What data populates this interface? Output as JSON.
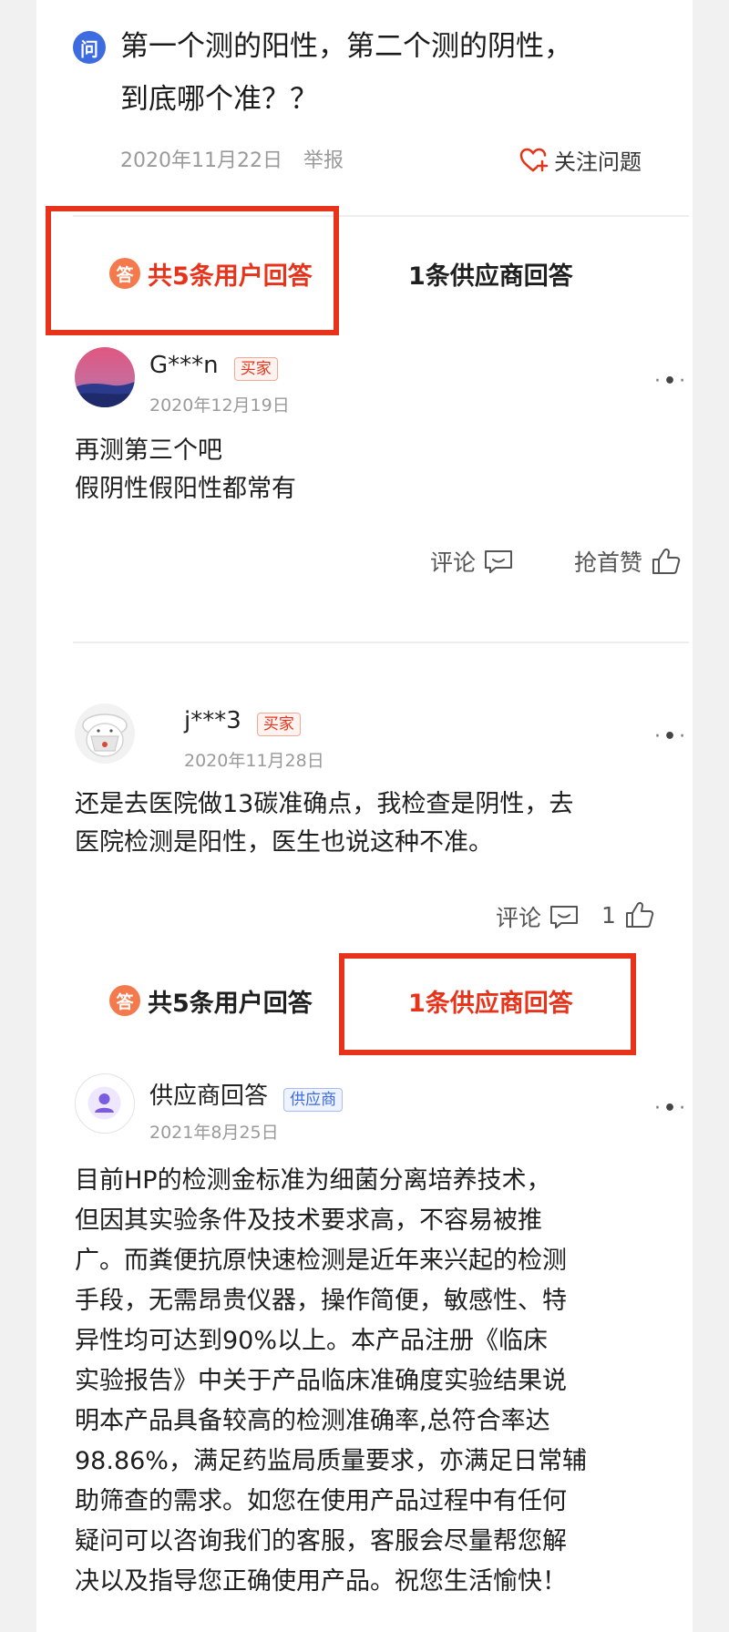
{
  "question": {
    "icon_label": "问",
    "title_line1": "第一个测的阳性，第二个测的阴性，",
    "title_line2": "到底哪个准？？",
    "date": "2020年11月22日",
    "report": "举报",
    "follow": "关注问题"
  },
  "tabs": {
    "badge": "答",
    "user_answers": "共5条用户回答",
    "supplier_answers": "1条供应商回答"
  },
  "answers": [
    {
      "user": "G***n",
      "tag": "买家",
      "date": "2020年12月19日",
      "line1": "再测第三个吧",
      "line2": "假阴性假阳性都常有",
      "comment": "评论",
      "like": "抢首赞"
    },
    {
      "user": "j***3",
      "tag": "买家",
      "date": "2020年11月28日",
      "line1": "还是去医院做13碳准确点，我检查是阴性，去",
      "line2": "医院检测是阳性，医生也说这种不准。",
      "comment": "评论",
      "like": "1"
    }
  ],
  "supplier": {
    "name": "供应商回答",
    "tag": "供应商",
    "date": "2021年8月25日",
    "lines": [
      "目前HP的检测金标准为细菌分离培养技术，",
      "但因其实验条件及技术要求高，不容易被推",
      "广。而粪便抗原快速检测是近年来兴起的检测",
      "手段，无需昂贵仪器，操作简便，敏感性、特",
      "异性均可达到90%以上。本产品注册《临床",
      "实验报告》中关于产品临床准确度实验结果说",
      "明本产品具备较高的检测准确率,总符合率达",
      "98.86%，满足药监局质量要求，亦满足日常辅",
      "助筛查的需求。如您在使用产品过程中有任何",
      "疑问可以咨询我们的客服，客服会尽量帮您解",
      "决以及指导您正确使用产品。祝您生活愉快！"
    ]
  },
  "colors": {
    "highlight": "#e8331b",
    "badge": "#f47a4d",
    "question_icon": "#3d6be0"
  }
}
